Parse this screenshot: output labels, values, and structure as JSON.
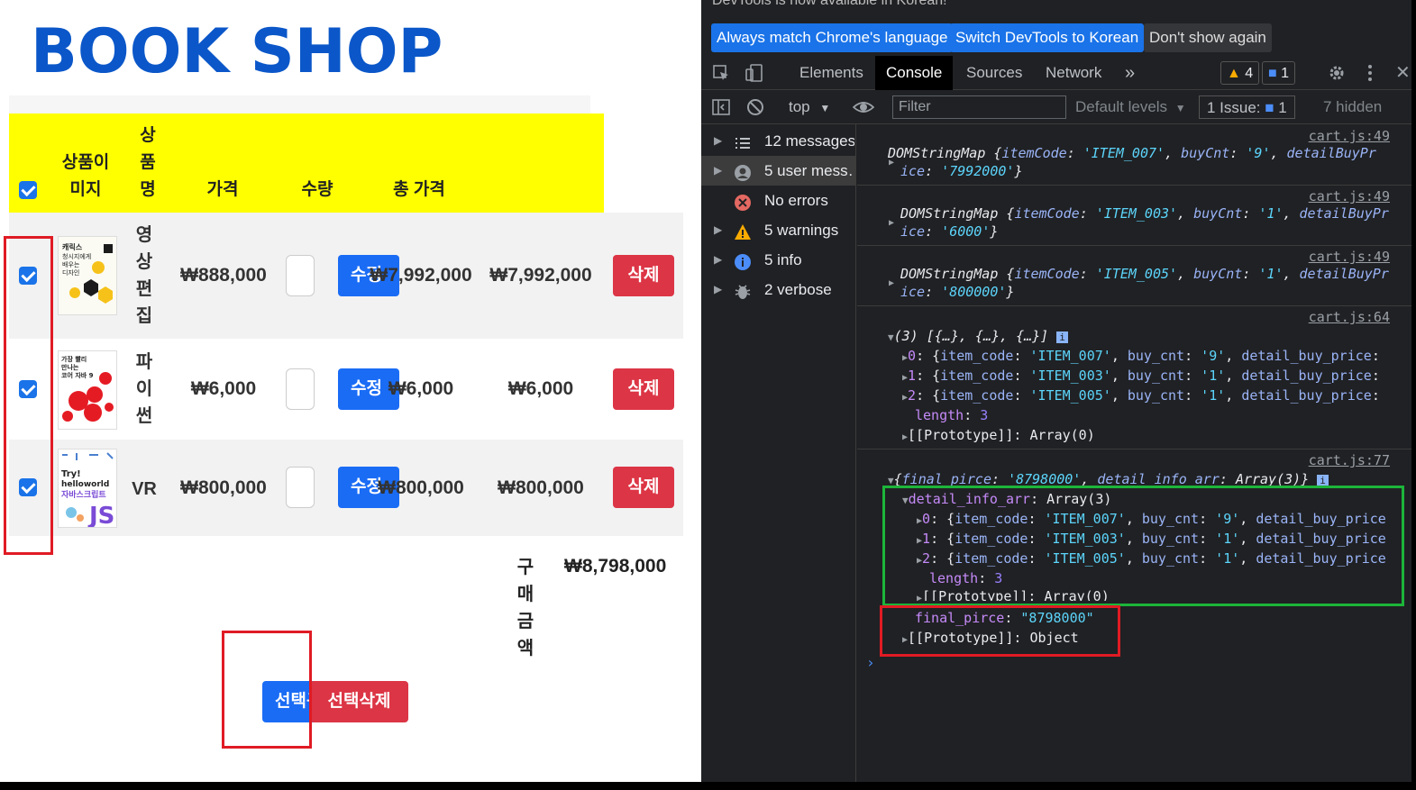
{
  "shop": {
    "title": "BOOK SHOP",
    "headers": {
      "image": [
        "상품이",
        "미지"
      ],
      "name": [
        "상",
        "품",
        "명"
      ],
      "price": "가격",
      "qty": "수량",
      "total": "총 가격"
    },
    "rows": [
      {
        "name": [
          "영",
          "상",
          "편",
          "집"
        ],
        "price": "₩888,000",
        "subtotal": "₩7,992,000",
        "total": "₩7,992,000",
        "edit_label": "수정",
        "delete_label": "삭제",
        "thumb_text": "캐릭스 청시지에게 배우는 디자인",
        "checked": true
      },
      {
        "name": [
          "파",
          "이",
          "썬"
        ],
        "price": "₩6,000",
        "subtotal": "₩6,000",
        "total": "₩6,000",
        "edit_label": "수정",
        "delete_label": "삭제",
        "thumb_text": "가장 빨리 만나는 코어 자바 9",
        "checked": true
      },
      {
        "name": [
          "VR"
        ],
        "price": "₩800,000",
        "subtotal": "₩800,000",
        "total": "₩800,000",
        "edit_label": "수정",
        "delete_label": "삭제",
        "thumb_text": "Try! helloworld 자바스크립트",
        "checked": true
      }
    ],
    "purchase_label": [
      "구",
      "매",
      "금",
      "액"
    ],
    "purchase_total": "₩8,798,000",
    "select_label": "선택구매",
    "select_delete_label": "선택삭제",
    "colors": {
      "title": "#0b57c9",
      "header_bg": "#ffff00",
      "primary": "#1a6cf5",
      "danger": "#dc3545",
      "annotation_red": "#e01b24"
    }
  },
  "devtools": {
    "infobar": {
      "faded": "DevTools is now available in Korean!",
      "btn_match": "Always match Chrome's language",
      "btn_switch": "Switch DevTools to Korean",
      "btn_dont": "Don't show again"
    },
    "tabs": [
      "Elements",
      "Console",
      "Sources",
      "Network"
    ],
    "active_tab": "Console",
    "more_tabs": "»",
    "warnings_badge": "4",
    "issues_badge": "1",
    "context": "top",
    "filter_placeholder": "Filter",
    "levels": "Default levels",
    "issues_label": "1 Issue:",
    "issues_count": "1",
    "hidden": "7 hidden",
    "sidebar": [
      {
        "label": "12 messages",
        "icon": "list-icon"
      },
      {
        "label": "5 user mess…",
        "icon": "user-icon"
      },
      {
        "label": "No errors",
        "icon": "error-icon"
      },
      {
        "label": "5 warnings",
        "icon": "warning-icon"
      },
      {
        "label": "5 info",
        "icon": "info-icon"
      },
      {
        "label": "2 verbose",
        "icon": "bug-icon"
      }
    ],
    "logs": [
      {
        "src": "cart.js:49",
        "code": "ITEM_007",
        "cnt": "9",
        "price": "7992000"
      },
      {
        "src": "cart.js:49",
        "code": "ITEM_003",
        "cnt": "1",
        "price": "6000"
      },
      {
        "src": "cart.js:49",
        "code": "ITEM_005",
        "cnt": "1",
        "price": "800000"
      }
    ],
    "array_log": {
      "src": "cart.js:64",
      "summary": "(3) [{…}, {…}, {…}]",
      "items": [
        {
          "idx": "0",
          "code": "ITEM_007",
          "cnt": "9"
        },
        {
          "idx": "1",
          "code": "ITEM_003",
          "cnt": "1"
        },
        {
          "idx": "2",
          "code": "ITEM_005",
          "cnt": "1"
        }
      ],
      "length": "3",
      "proto": "Array(0)"
    },
    "object_log": {
      "src": "cart.js:77",
      "summary_price": "'8798000'",
      "summary_arr": "Array(3)",
      "detail_key": "detail_info_arr",
      "detail_val": "Array(3)",
      "length": "3",
      "proto_arr": "Array(0)",
      "final_key": "final_pirce",
      "final_val": "\"8798000\"",
      "proto_obj": "Object"
    },
    "colors": {
      "bg": "#202124",
      "accent": "#1a73e8",
      "annotation_green": "#1cb53a"
    }
  }
}
